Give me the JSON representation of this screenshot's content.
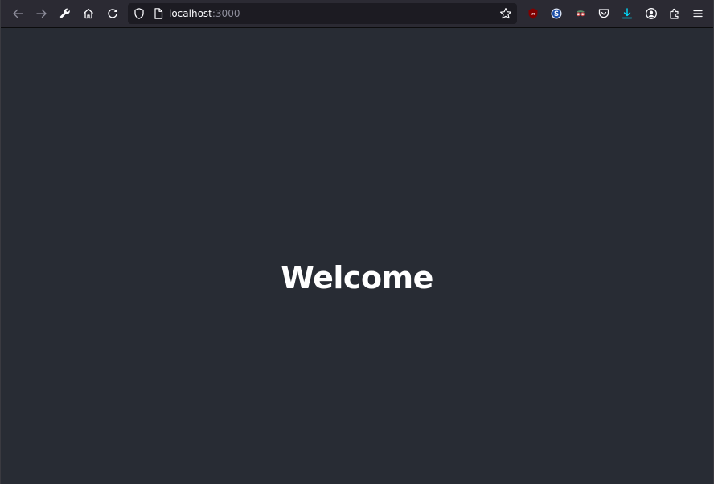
{
  "browser": {
    "url": {
      "host": "localhost",
      "port": ":3000"
    },
    "toolbar": {
      "left_icons": [
        "back-arrow-icon",
        "forward-arrow-icon",
        "wrench-icon",
        "home-icon",
        "reload-icon"
      ],
      "right_icons": [
        "ublock-origin-icon",
        "s-extension-icon",
        "glasses-extension-icon",
        "pocket-icon",
        "downloads-icon",
        "account-icon",
        "extensions-icon",
        "menu-icon"
      ]
    },
    "colors": {
      "toolbar_bg": "#2b2a33",
      "urlbar_bg": "#1c1b22",
      "icon": "#fbfbfe",
      "icon_disabled": "#8f8f9d",
      "ublock_red": "#800000",
      "download_accent": "#00ddff",
      "page_bg": "#282c34"
    }
  },
  "page": {
    "heading": "Welcome",
    "background": "#282c34",
    "text_color": "#ffffff"
  }
}
